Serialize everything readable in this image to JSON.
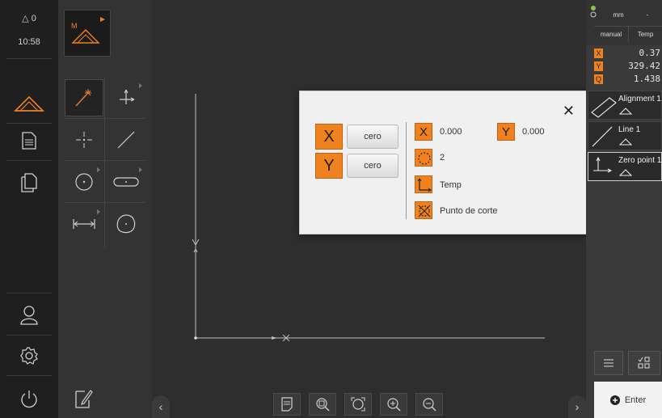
{
  "mainnav": {
    "status_text": "△ 0",
    "clock": "10:58"
  },
  "dialog": {
    "cero_x_label": "cero",
    "cero_y_label": "cero",
    "axis_x": "X",
    "axis_y": "Y",
    "x_value": "0.000",
    "y_value": "0.000",
    "points_count": "2",
    "ref_system": "Temp",
    "construction_method": "Punto de corte"
  },
  "inspector": {
    "unit": "mm",
    "unit_right": "-",
    "mode": "manual",
    "ref": "Temp",
    "positions": [
      {
        "axis": "X",
        "value": "0.37"
      },
      {
        "axis": "Y",
        "value": "329.42"
      },
      {
        "axis": "Q",
        "value": "1.438"
      }
    ],
    "features": [
      {
        "label": "Alignment 1"
      },
      {
        "label": "Line 1"
      },
      {
        "label": "Zero point 1"
      }
    ],
    "enter_label": "Enter"
  },
  "colors": {
    "accent": "#f0811f",
    "background": "#2e2e2e",
    "dialog": "#f0f0f0"
  }
}
